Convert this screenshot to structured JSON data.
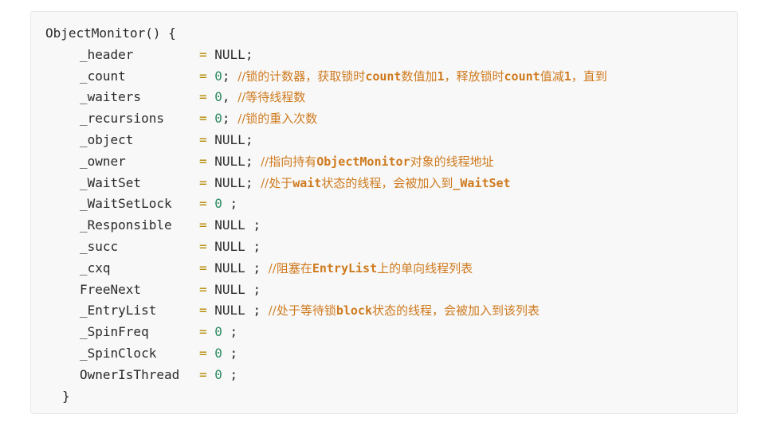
{
  "header": "ObjectMonitor() {",
  "footer": "}",
  "fields": [
    {
      "name": "_header",
      "val": "NULL",
      "type": "null",
      "sep": ";",
      "comment": []
    },
    {
      "name": "_count",
      "val": "0",
      "type": "num",
      "sep": ";",
      "comment": [
        {
          "t": "//锁的计数器，获取锁时",
          "kw": false
        },
        {
          "t": "count",
          "kw": true
        },
        {
          "t": "数值加",
          "kw": false
        },
        {
          "t": "1",
          "kw": true
        },
        {
          "t": "，释放锁时",
          "kw": false
        },
        {
          "t": "count",
          "kw": true
        },
        {
          "t": "值减",
          "kw": false
        },
        {
          "t": "1",
          "kw": true
        },
        {
          "t": "，直到",
          "kw": false
        }
      ]
    },
    {
      "name": "_waiters",
      "val": "0",
      "type": "num",
      "sep": ",",
      "comment": [
        {
          "t": "//等待线程数",
          "kw": false
        }
      ]
    },
    {
      "name": "_recursions",
      "val": "0",
      "type": "num",
      "sep": ";",
      "comment": [
        {
          "t": "//锁的重入次数",
          "kw": false
        }
      ]
    },
    {
      "name": "_object",
      "val": "NULL",
      "type": "null",
      "sep": ";",
      "comment": []
    },
    {
      "name": "_owner",
      "val": "NULL",
      "type": "null",
      "sep": ";",
      "comment": [
        {
          "t": "//指向持有",
          "kw": false
        },
        {
          "t": "ObjectMonitor",
          "kw": true
        },
        {
          "t": "对象的线程地址",
          "kw": false
        }
      ]
    },
    {
      "name": "_WaitSet",
      "val": "NULL",
      "type": "null",
      "sep": ";",
      "comment": [
        {
          "t": "//处于",
          "kw": false
        },
        {
          "t": "wait",
          "kw": true
        },
        {
          "t": "状态的线程，会被加入到",
          "kw": false
        },
        {
          "t": "_WaitSet",
          "kw": true
        }
      ]
    },
    {
      "name": "_WaitSetLock",
      "val": "0",
      "type": "num",
      "sep": " ;",
      "comment": []
    },
    {
      "name": "_Responsible",
      "val": "NULL",
      "type": "null",
      "sep": " ;",
      "comment": []
    },
    {
      "name": "_succ",
      "val": "NULL",
      "type": "null",
      "sep": " ;",
      "comment": []
    },
    {
      "name": "_cxq",
      "val": "NULL",
      "type": "null",
      "sep": " ;",
      "comment": [
        {
          "t": "//阻塞在",
          "kw": false
        },
        {
          "t": "EntryList",
          "kw": true
        },
        {
          "t": "上的单向线程列表",
          "kw": false
        }
      ]
    },
    {
      "name": "FreeNext",
      "val": "NULL",
      "type": "null",
      "sep": " ;",
      "comment": []
    },
    {
      "name": "_EntryList",
      "val": "NULL",
      "type": "null",
      "sep": " ;",
      "comment": [
        {
          "t": "//处于等待锁",
          "kw": false
        },
        {
          "t": "block",
          "kw": true
        },
        {
          "t": "状态的线程，会被加入到该列表",
          "kw": false
        }
      ]
    },
    {
      "name": "_SpinFreq",
      "val": "0",
      "type": "num",
      "sep": " ;",
      "comment": []
    },
    {
      "name": "_SpinClock",
      "val": "0",
      "type": "num",
      "sep": " ;",
      "comment": []
    },
    {
      "name": "OwnerIsThread",
      "val": "0",
      "type": "num",
      "sep": " ;",
      "comment": []
    }
  ],
  "colors": {
    "background": "#f8f8f8",
    "text": "#2b2b2b",
    "operator": "#b58900",
    "number": "#2a8a5f",
    "comment": "#cf7a1e"
  }
}
